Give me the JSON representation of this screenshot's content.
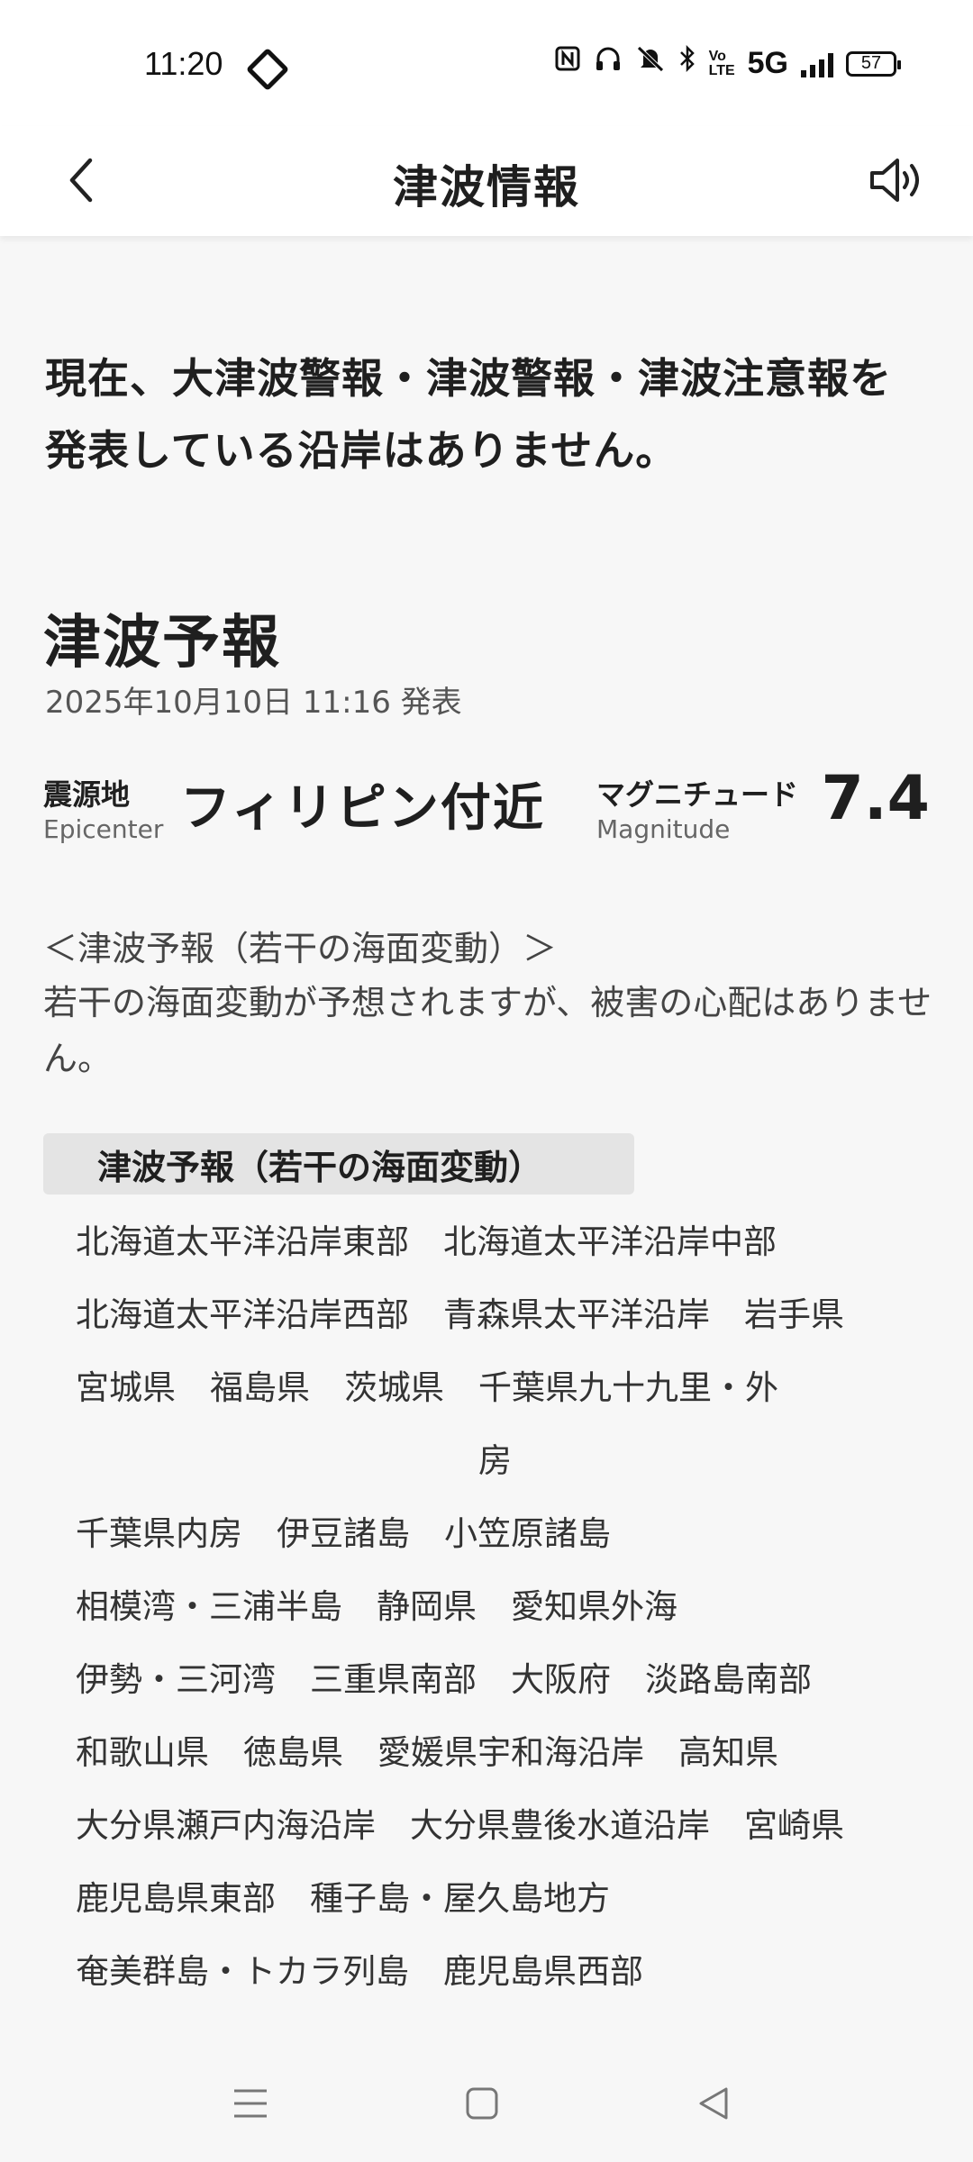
{
  "status_bar": {
    "time": "11:20",
    "network": "5G",
    "volte": "Vo\nLTE",
    "battery": "57"
  },
  "app_bar": {
    "title": "津波情報"
  },
  "notice": "現在、大津波警報・津波警報・津波注意報を発表している沿岸はありません。",
  "forecast": {
    "title": "津波予報",
    "issued": "2025年10月10日 11:16 発表",
    "epicenter_label_jp": "震源地",
    "epicenter_label_en": "Epicenter",
    "epicenter": "フィリピン付近",
    "magnitude_label_jp": "マグニチュード",
    "magnitude_label_en": "Magnitude",
    "magnitude": "7.4",
    "category_heading": "＜津波予報（若干の海面変動）＞",
    "category_description": "若干の海面変動が予想されますが、被害の心配はありません。",
    "region_header": "津波予報（若干の海面変動）",
    "regions": [
      "北海道太平洋沿岸東部",
      "北海道太平洋沿岸中部",
      "北海道太平洋沿岸西部",
      "青森県太平洋沿岸",
      "岩手県",
      "宮城県",
      "福島県",
      "茨城県",
      "千葉県九十九里・外",
      "房",
      "千葉県内房",
      "伊豆諸島",
      "小笠原諸島",
      "相模湾・三浦半島",
      "静岡県",
      "愛知県外海",
      "伊勢・三河湾",
      "三重県南部",
      "大阪府",
      "淡路島南部",
      "和歌山県",
      "徳島県",
      "愛媛県宇和海沿岸",
      "高知県",
      "大分県瀬戸内海沿岸",
      "大分県豊後水道沿岸",
      "宮崎県",
      "鹿児島県東部",
      "種子島・屋久島地方",
      "奄美群島・トカラ列島",
      "鹿児島県西部"
    ]
  },
  "icons": {
    "back": "back-arrow-icon",
    "speaker": "speaker-icon",
    "menu": "menu-icon",
    "home": "home-icon",
    "nav_back": "nav-back-icon"
  }
}
